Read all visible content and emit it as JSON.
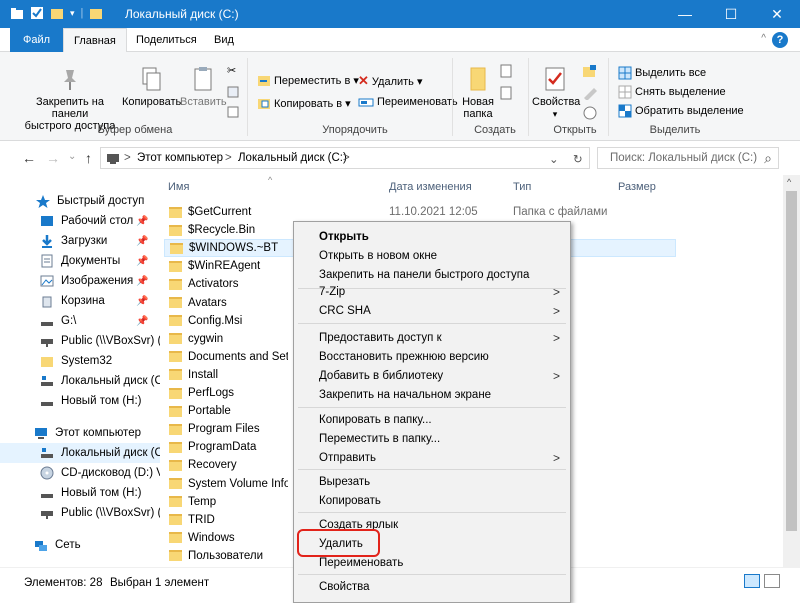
{
  "window": {
    "title": "Локальный диск (C:)",
    "minimize": "—",
    "maximize": "☐",
    "close": "✕",
    "accent": "#1979ca"
  },
  "ribbon_tabs": {
    "file": "Файл",
    "home": "Главная",
    "share": "Поделиться",
    "view": "Вид",
    "help": "?"
  },
  "ribbon": {
    "pin_quick_line1": "Закрепить на панели",
    "pin_quick_line2": "быстрого доступа",
    "copy": "Копировать",
    "paste": "Вставить",
    "clipboard_group": "Буфер обмена",
    "move_to": "Переместить в ▾",
    "copy_to": "Копировать в ▾",
    "delete": "Удалить ▾",
    "rename": "Переименовать",
    "organize_group": "Упорядочить",
    "new_folder_line1": "Новая",
    "new_folder_line2": "папка",
    "create_group": "Создать",
    "properties": "Свойства",
    "properties_arrow": "▾",
    "open_group": "Открыть",
    "select_all": "Выделить все",
    "select_none": "Снять выделение",
    "invert_selection": "Обратить выделение",
    "select_group": "Выделить"
  },
  "nav": {
    "back": "←",
    "forward": "→",
    "recent": "⌄",
    "up": "↑",
    "crumb_root": "Этот компьютер",
    "crumb_drive": "Локальный диск (C:)",
    "sep": ">",
    "dropdown": "⌄",
    "refresh": "↻",
    "search_placeholder": "Поиск: Локальный диск (C:)",
    "search_icon": "⌕"
  },
  "sidebar": {
    "items": [
      {
        "label": "Быстрый доступ"
      },
      {
        "label": "Рабочий стол"
      },
      {
        "label": "Загрузки"
      },
      {
        "label": "Документы"
      },
      {
        "label": "Изображения"
      },
      {
        "label": "Корзина"
      },
      {
        "label": "G:\\"
      },
      {
        "label": "Public (\\\\VBoxSvr) ("
      },
      {
        "label": "System32"
      },
      {
        "label": "Локальный диск (C"
      },
      {
        "label": "Новый том (H:)"
      },
      {
        "label": "Этот компьютер"
      },
      {
        "label": "Локальный диск (C"
      },
      {
        "label": "CD-дисковод (D:) V"
      },
      {
        "label": "Новый том (H:)"
      },
      {
        "label": "Public (\\\\VBoxSvr) ("
      },
      {
        "label": "Сеть"
      }
    ],
    "pin_glyph": "📌"
  },
  "columns": {
    "name": "Имя",
    "date": "Дата изменения",
    "type": "Тип",
    "size": "Размер",
    "sort_glyph": "^"
  },
  "files": [
    {
      "name": "$GetCurrent",
      "date": "11.10.2021 12:05",
      "type": "Папка с файлами"
    },
    {
      "name": "$Recycle.Bin",
      "date": "",
      "type": "лами"
    },
    {
      "name": "$WINDOWS.~BT",
      "date": "",
      "type": "лами"
    },
    {
      "name": "$WinREAgent",
      "date": "",
      "type": "лами"
    },
    {
      "name": "Activators",
      "date": "",
      "type": "лами"
    },
    {
      "name": "Avatars",
      "date": "",
      "type": "лами"
    },
    {
      "name": "Config.Msi",
      "date": "",
      "type": "лами"
    },
    {
      "name": "cygwin",
      "date": "",
      "type": "лами"
    },
    {
      "name": "Documents and Settings",
      "date": "",
      "type": "лами"
    },
    {
      "name": "Install",
      "date": "",
      "type": "лами"
    },
    {
      "name": "PerfLogs",
      "date": "",
      "type": "лами"
    },
    {
      "name": "Portable",
      "date": "",
      "type": "лами"
    },
    {
      "name": "Program Files",
      "date": "",
      "type": "лами"
    },
    {
      "name": "ProgramData",
      "date": "",
      "type": "лами"
    },
    {
      "name": "Recovery",
      "date": "",
      "type": "лами"
    },
    {
      "name": "System Volume Information",
      "date": "",
      "type": "лами"
    },
    {
      "name": "Temp",
      "date": "",
      "type": "лами"
    },
    {
      "name": "TRID",
      "date": "",
      "type": "лами"
    },
    {
      "name": "Windows",
      "date": "",
      "type": "лами"
    },
    {
      "name": "Пользователи",
      "date": "",
      "type": "лами"
    }
  ],
  "context_menu": {
    "items": [
      {
        "label": "Открыть"
      },
      {
        "label": "Открыть в новом окне"
      },
      {
        "label": "Закрепить на панели быстрого доступа"
      },
      {
        "label": "7-Zip"
      },
      {
        "label": "CRC SHA"
      },
      {
        "label": "Предоставить доступ к"
      },
      {
        "label": "Восстановить прежнюю версию"
      },
      {
        "label": "Добавить в библиотеку"
      },
      {
        "label": "Закрепить на начальном экране"
      },
      {
        "label": "Копировать в папку..."
      },
      {
        "label": "Переместить в папку..."
      },
      {
        "label": "Отправить"
      },
      {
        "label": "Вырезать"
      },
      {
        "label": "Копировать"
      },
      {
        "label": "Создать ярлык"
      },
      {
        "label": "Удалить"
      },
      {
        "label": "Переименовать"
      },
      {
        "label": "Свойства"
      }
    ],
    "submenu_arrow": ">",
    "highlight_color": "#e2231a"
  },
  "status": {
    "count": "Элементов: 28",
    "selected": "Выбран 1 элемент"
  }
}
